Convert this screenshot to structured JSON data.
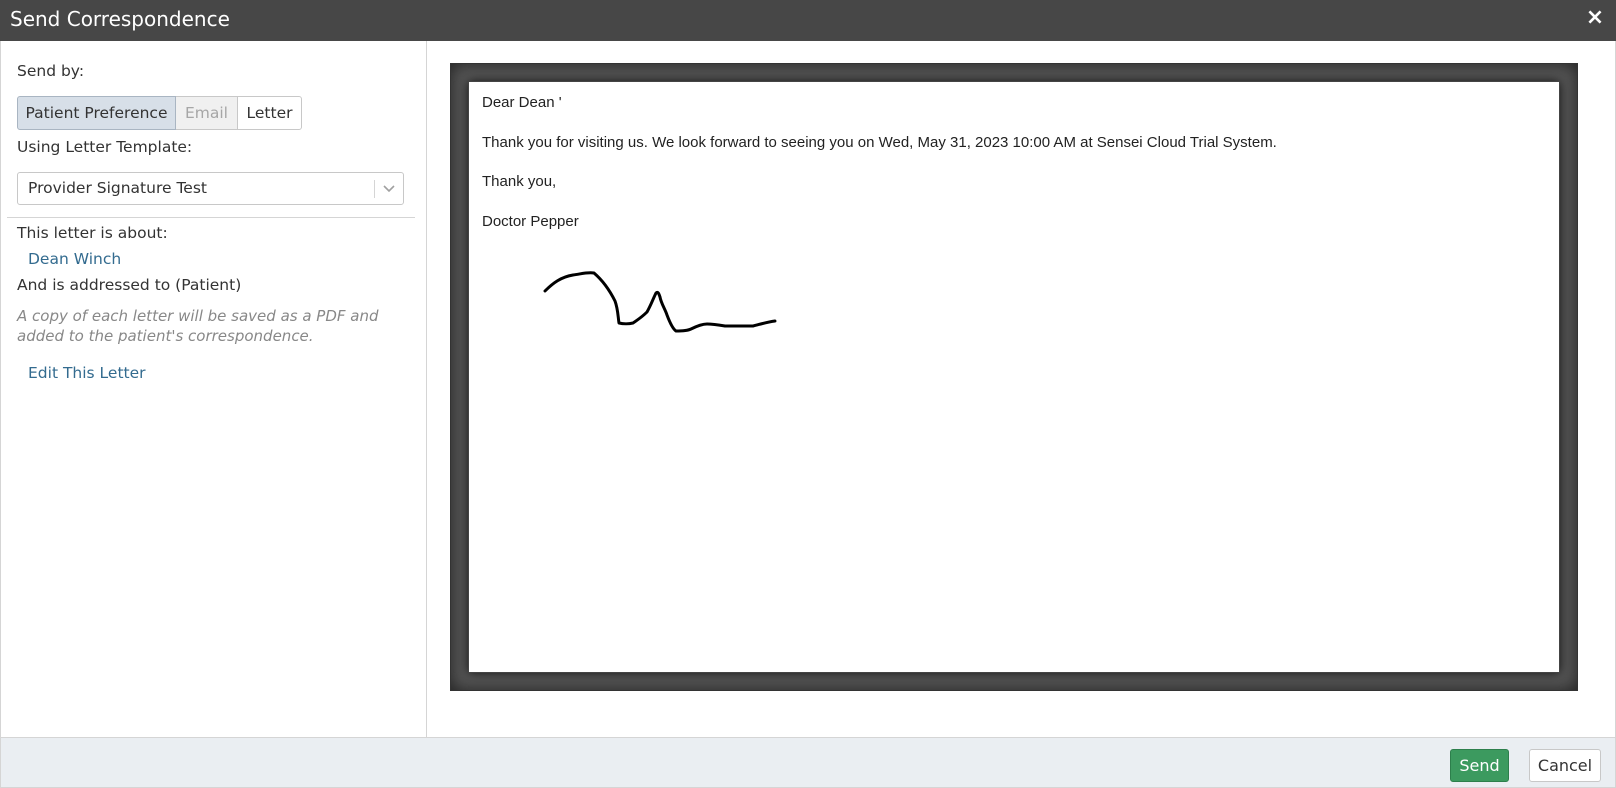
{
  "dialog": {
    "title": "Send Correspondence",
    "close_icon": "×"
  },
  "left": {
    "send_by_label": "Send by:",
    "send_options": [
      {
        "label": "Patient Preference",
        "state": "selected"
      },
      {
        "label": "Email",
        "state": "disabled"
      },
      {
        "label": "Letter",
        "state": "normal"
      }
    ],
    "template_label": "Using Letter Template:",
    "template_value": "Provider Signature Test",
    "about_label": "This letter is about:",
    "patient_link": "Dean Winch",
    "addressed_label": "And is addressed to (Patient)",
    "note": "A copy of each letter will be saved as a PDF and added to the patient's correspondence.",
    "edit_link": "Edit This Letter"
  },
  "letter": {
    "greeting": "Dear Dean '",
    "body": "Thank you for visiting us. We look forward to seeing you on Wed, May 31, 2023 10:00 AM at Sensei Cloud Trial System.",
    "closing": "Thank you,",
    "signer": "Doctor Pepper"
  },
  "footer": {
    "send_label": "Send",
    "cancel_label": "Cancel"
  },
  "colors": {
    "titlebar": "#474747",
    "link": "#336b8f",
    "send_button": "#3c9a5f",
    "selected_option": "#d7dfe8"
  }
}
